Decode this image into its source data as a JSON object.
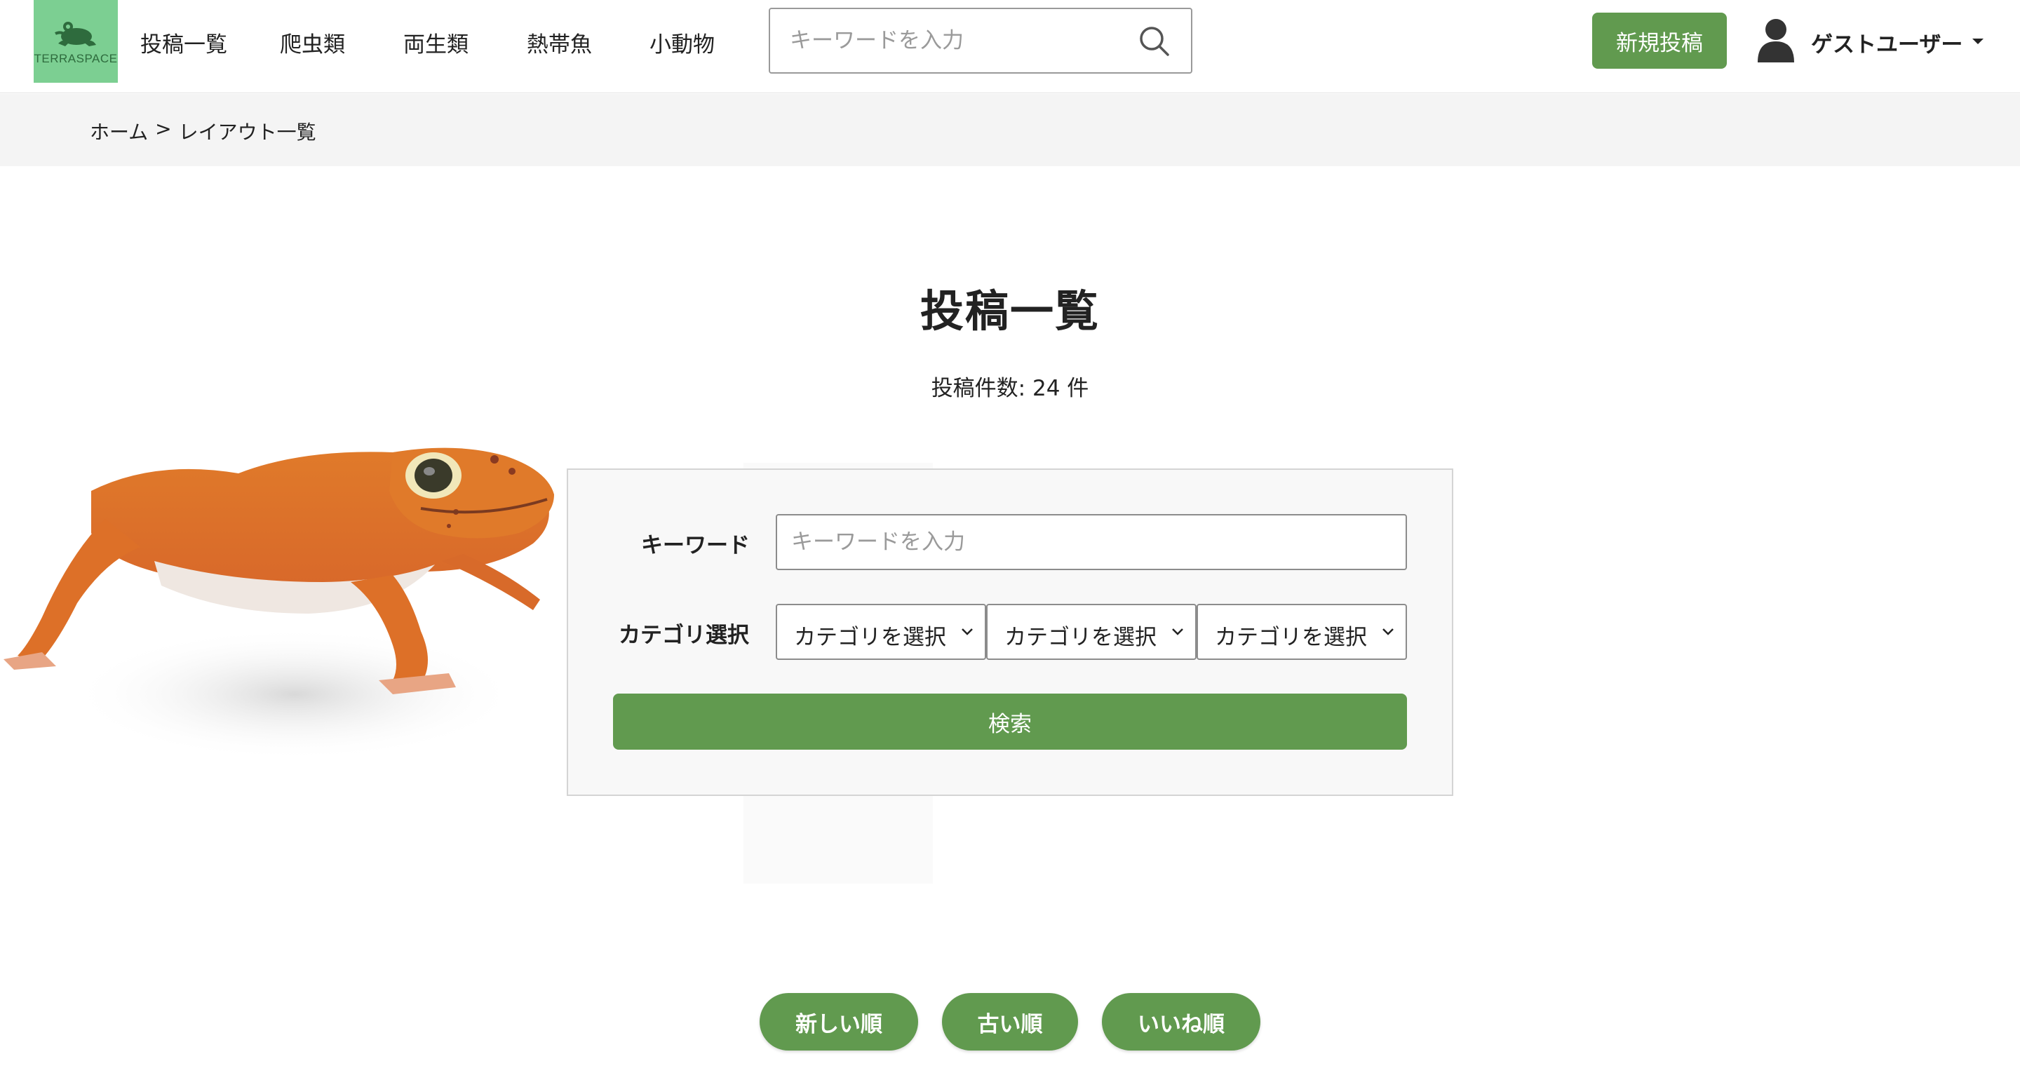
{
  "header": {
    "logo_text": "TERRASPACE",
    "nav": [
      "投稿一覧",
      "爬虫類",
      "両生類",
      "熱帯魚",
      "小動物"
    ],
    "search_placeholder": "キーワードを入力",
    "new_post_label": "新規投稿",
    "user_name": "ゲストユーザー",
    "icons": {
      "logo": "frog-icon",
      "search": "search-icon",
      "avatar": "user-avatar-icon",
      "caret": "caret-down-icon"
    }
  },
  "breadcrumb": {
    "home": "ホーム",
    "separator": ">",
    "current": "レイアウト一覧"
  },
  "main": {
    "title": "投稿一覧",
    "post_count_text": "投稿件数: 24 件"
  },
  "search_form": {
    "keyword_label": "キーワード",
    "keyword_placeholder": "キーワードを入力",
    "category_label": "カテゴリ選択",
    "category_selects": [
      "カテゴリを選択",
      "カテゴリを選択",
      "カテゴリを選択"
    ],
    "submit_label": "検索"
  },
  "sort": {
    "buttons": [
      "新しい順",
      "古い順",
      "いいね順"
    ]
  },
  "colors": {
    "brand_green": "#619a4f",
    "logo_green": "#7ccf92",
    "breadcrumb_bg": "#f4f4f4",
    "panel_bg": "#f8f8f8"
  }
}
